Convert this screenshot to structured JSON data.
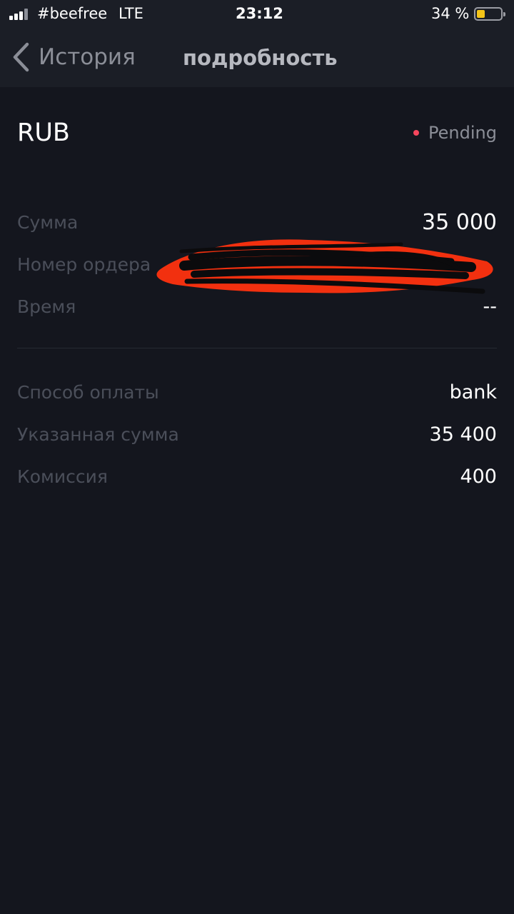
{
  "status_bar": {
    "carrier": "#beefree",
    "network": "LTE",
    "time": "23:12",
    "battery_percent_text": "34 %",
    "battery_level": 0.34
  },
  "nav": {
    "back_label": "История",
    "title": "подробность"
  },
  "header": {
    "currency": "RUB",
    "status": "Pending",
    "status_color": "#f6465d"
  },
  "details": [
    {
      "label": "Сумма",
      "value": "35 000"
    },
    {
      "label": "Номер ордера",
      "value": ""
    },
    {
      "label": "Время",
      "value": "--"
    }
  ],
  "payment": [
    {
      "label": "Способ оплаты",
      "value": "bank"
    },
    {
      "label": "Указанная сумма",
      "value": "35 400"
    },
    {
      "label": "Комиссия",
      "value": "400"
    }
  ],
  "colors": {
    "background": "#14161e",
    "bar": "#1b1e26",
    "label": "#4b4f5a",
    "value": "#ffffff",
    "pending": "#f6465d",
    "redaction_red": "#f2300f",
    "redaction_black": "#0b0b0d"
  }
}
